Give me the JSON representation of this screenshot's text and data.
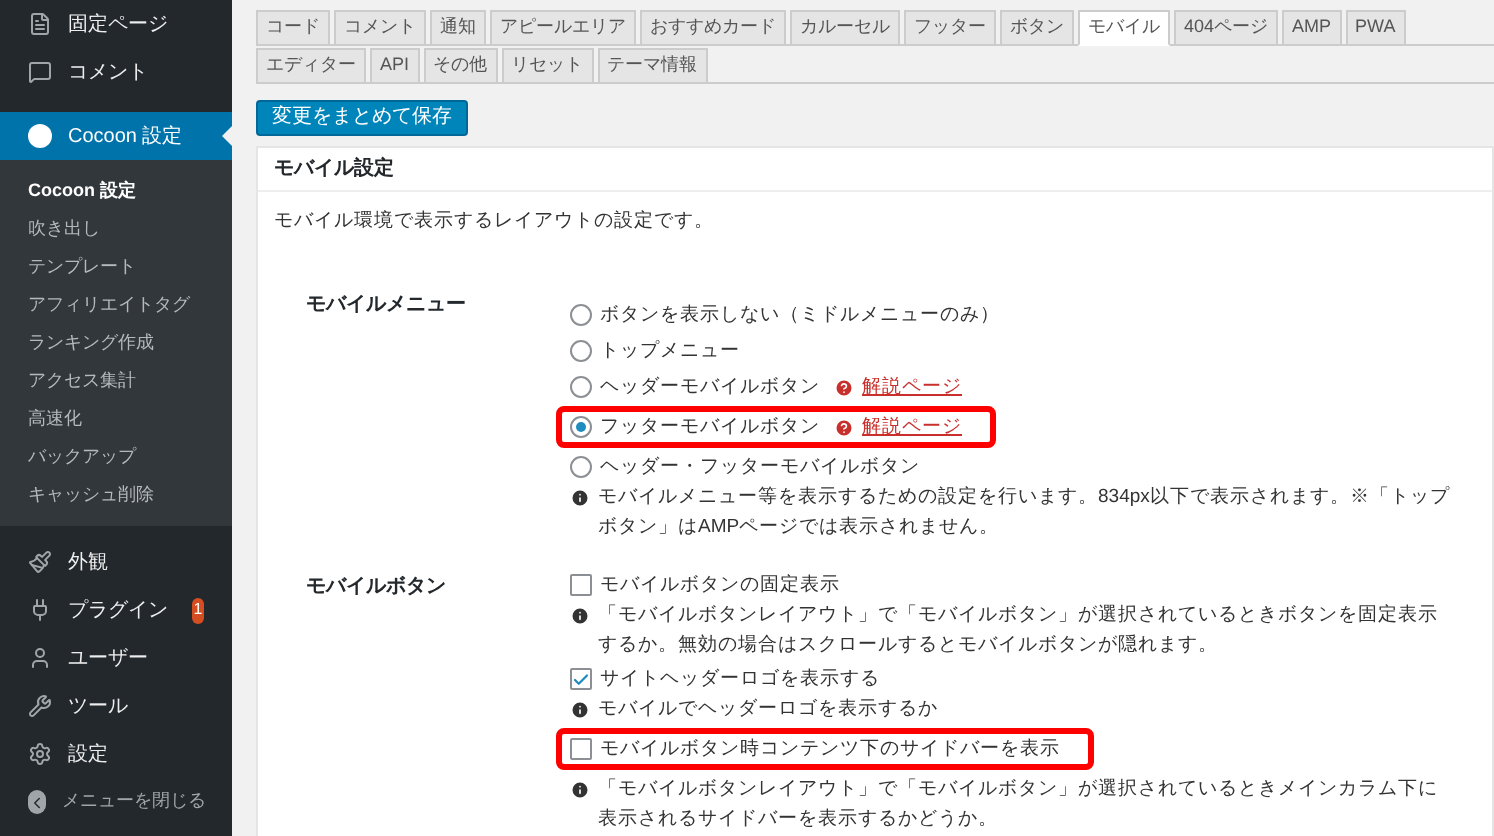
{
  "sidebar": {
    "items": [
      {
        "label": "固定ページ",
        "selected": false
      },
      {
        "label": "コメント",
        "selected": false
      },
      {
        "label": "Cocoon 設定",
        "selected": true,
        "children": [
          {
            "label": "Cocoon 設定",
            "selected": true
          },
          {
            "label": "吹き出し",
            "selected": false
          },
          {
            "label": "テンプレート",
            "selected": false
          },
          {
            "label": "アフィリエイトタグ",
            "selected": false
          },
          {
            "label": "ランキング作成",
            "selected": false
          },
          {
            "label": "アクセス集計",
            "selected": false
          },
          {
            "label": "高速化",
            "selected": false
          },
          {
            "label": "バックアップ",
            "selected": false
          },
          {
            "label": "キャッシュ削除",
            "selected": false
          }
        ]
      },
      {
        "label": "外観",
        "selected": false
      },
      {
        "label": "プラグイン",
        "selected": false,
        "badge": "1"
      },
      {
        "label": "ユーザー",
        "selected": false
      },
      {
        "label": "ツール",
        "selected": false
      },
      {
        "label": "設定",
        "selected": false
      }
    ],
    "collapse": "メニューを閉じる"
  },
  "tab_rows": [
    [
      {
        "label": "コード",
        "selected": false
      },
      {
        "label": "コメント",
        "selected": false
      },
      {
        "label": "通知",
        "selected": false
      },
      {
        "label": "アピールエリア",
        "selected": false
      },
      {
        "label": "おすすめカード",
        "selected": false
      },
      {
        "label": "カルーセル",
        "selected": false
      },
      {
        "label": "フッター",
        "selected": false
      },
      {
        "label": "ボタン",
        "selected": false
      },
      {
        "label": "モバイル",
        "selected": true
      },
      {
        "label": "404ページ",
        "selected": false
      },
      {
        "label": "AMP",
        "selected": false
      },
      {
        "label": "PWA",
        "selected": false
      }
    ],
    [
      {
        "label": "エディター",
        "selected": false
      },
      {
        "label": "API",
        "selected": false
      },
      {
        "label": "その他",
        "selected": false
      },
      {
        "label": "リセット",
        "selected": false
      },
      {
        "label": "テーマ情報",
        "selected": false
      }
    ]
  ],
  "save_button": "変更をまとめて保存",
  "panel": {
    "title": "モバイル設定",
    "description": "モバイル環境で表示するレイアウトの設定です。",
    "settings": [
      {
        "label": "モバイルメニュー",
        "options": [
          {
            "kind": "radio",
            "label": "ボタンを表示しない（ミドルメニューのみ）",
            "selected": false,
            "highlighted": false
          },
          {
            "kind": "radio",
            "label": "トップメニュー",
            "selected": false,
            "highlighted": false
          },
          {
            "kind": "radio",
            "label": "ヘッダーモバイルボタン",
            "link": "解説ページ",
            "selected": false,
            "highlighted": false
          },
          {
            "kind": "radio",
            "label": "フッターモバイルボタン",
            "link": "解説ページ",
            "selected": true,
            "highlighted": true
          },
          {
            "kind": "radio",
            "label": "ヘッダー・フッターモバイルボタン",
            "selected": false,
            "highlighted": false
          },
          {
            "kind": "note",
            "label": "モバイルメニュー等を表示するための設定を行います。834px以下で表示されます。※「トップボタン」はAMPページでは表示されません。"
          }
        ]
      },
      {
        "label": "モバイルボタン",
        "options": [
          {
            "kind": "checkbox",
            "label": "モバイルボタンの固定表示",
            "checked": false,
            "highlighted": false
          },
          {
            "kind": "note",
            "label": "「モバイルボタンレイアウト」で「モバイルボタン」が選択されているときボタンを固定表示するか。無効の場合はスクロールするとモバイルボタンが隠れます。"
          },
          {
            "kind": "checkbox",
            "label": "サイトヘッダーロゴを表示する",
            "checked": true,
            "highlighted": false
          },
          {
            "kind": "note",
            "label": "モバイルでヘッダーロゴを表示するか"
          },
          {
            "kind": "checkbox",
            "label": "モバイルボタン時コンテンツ下のサイドバーを表示",
            "checked": false,
            "highlighted": true
          },
          {
            "kind": "note",
            "label": "「モバイルボタンレイアウト」で「モバイルボタン」が選択されているときメインカラム下に表示されるサイドバーを表示するかどうか。"
          }
        ]
      }
    ]
  }
}
